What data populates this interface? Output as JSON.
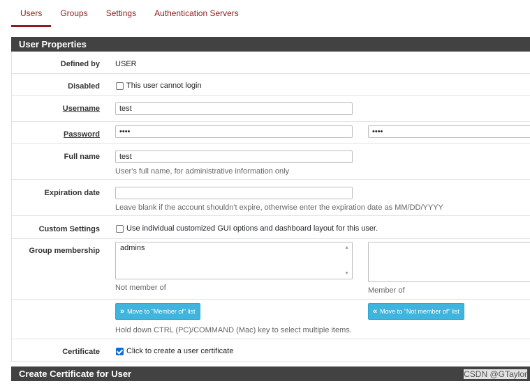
{
  "tabs": [
    {
      "label": "Users",
      "active": true
    },
    {
      "label": "Groups"
    },
    {
      "label": "Settings"
    },
    {
      "label": "Authentication Servers"
    }
  ],
  "panel_title": "User Properties",
  "fields": {
    "defined_by": {
      "label": "Defined by",
      "value": "USER"
    },
    "disabled": {
      "label": "Disabled",
      "checkbox_label": "This user cannot login",
      "checked": false
    },
    "username": {
      "label": "Username",
      "value": "test"
    },
    "password": {
      "label": "Password",
      "value": "••••",
      "confirm_value": "••••"
    },
    "full_name": {
      "label": "Full name",
      "value": "test",
      "help": "User's full name, for administrative information only"
    },
    "expiration": {
      "label": "Expiration date",
      "value": "",
      "help": "Leave blank if the account shouldn't expire, otherwise enter the expiration date as MM/DD/YYYY"
    },
    "custom_settings": {
      "label": "Custom Settings",
      "checkbox_label": "Use individual customized GUI options and dashboard layout for this user.",
      "checked": false
    },
    "group_membership": {
      "label": "Group membership",
      "not_member_items": [
        "admins"
      ],
      "not_member_caption": "Not member of",
      "member_items": [],
      "member_caption": "Member of"
    },
    "move_buttons": {
      "to_member": "Move to \"Member of\" list",
      "to_not_member": "Move to \"Not member of\" list",
      "help": "Hold down CTRL (PC)/COMMAND (Mac) key to select multiple items."
    },
    "certificate": {
      "label": "Certificate",
      "checkbox_label": "Click to create a user certificate",
      "checked": true
    }
  },
  "panel2_title": "Create Certificate for User",
  "watermark": "CSDN @GTaylor",
  "colors": {
    "accent": "#8f1d1d",
    "header_bg": "#424242",
    "button": "#3fb5dd",
    "checkbox": "#0b6fd3"
  }
}
